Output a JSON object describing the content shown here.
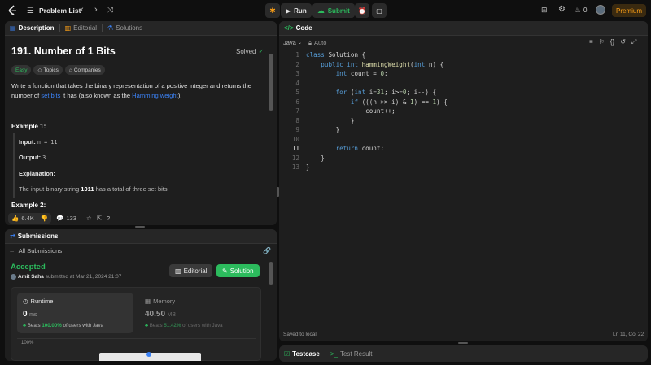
{
  "topbar": {
    "problem_list": "Problem List",
    "run": "Run",
    "submit": "Submit",
    "fire_count": "0",
    "premium": "Premium"
  },
  "left_tabs": {
    "description": "Description",
    "editorial": "Editorial",
    "solutions": "Solutions"
  },
  "problem": {
    "title": "191. Number of 1 Bits",
    "status": "Solved",
    "difficulty": "Easy",
    "topics": "Topics",
    "companies": "Companies",
    "desc_part1": "Write a function that takes the binary representation of a positive integer and returns the number of ",
    "desc_link1": "set bits",
    "desc_part2": " it has (also known as the ",
    "desc_link2": "Hamming weight",
    "desc_part3": ").",
    "example1_title": "Example 1:",
    "input_label": "Input:",
    "input_value": "n = 11",
    "output_label": "Output:",
    "output_value": "3",
    "explanation_label": "Explanation:",
    "explanation_part1": "The input binary string ",
    "explanation_bold": "1011",
    "explanation_part2": " has a total of three set bits.",
    "example2_title": "Example 2:",
    "likes": "6.4K",
    "comments": "133"
  },
  "submissions": {
    "header": "Submissions",
    "all_submissions": "All Submissions",
    "status": "Accepted",
    "user": "Amit Saha",
    "submitted_text": "submitted at Mar 21, 2024 21:07",
    "editorial_btn": "Editorial",
    "solution_btn": "Solution",
    "runtime_label": "Runtime",
    "runtime_value": "0",
    "runtime_unit": "ms",
    "runtime_beats_prefix": "Beats",
    "runtime_beats_pct": "100.00%",
    "runtime_beats_suffix": "of users with Java",
    "memory_label": "Memory",
    "memory_value": "40.50",
    "memory_unit": "MB",
    "memory_beats_prefix": "Beats",
    "memory_beats_pct": "51.42%",
    "memory_beats_suffix": "of users with Java",
    "chart_pct": "100%"
  },
  "code_panel": {
    "header": "Code",
    "language": "Java",
    "auto": "Auto",
    "saved": "Saved to local",
    "position": "Ln 11, Col 22",
    "line_numbers": [
      "1",
      "2",
      "3",
      "4",
      "5",
      "6",
      "7",
      "8",
      "9",
      "10",
      "11",
      "12",
      "13"
    ]
  },
  "bottom_tabs": {
    "testcase": "Testcase",
    "test_result": "Test Result"
  },
  "colors": {
    "accent_green": "#2cbb5d",
    "accent_orange": "#ffa116",
    "link_blue": "#3b82f6"
  }
}
